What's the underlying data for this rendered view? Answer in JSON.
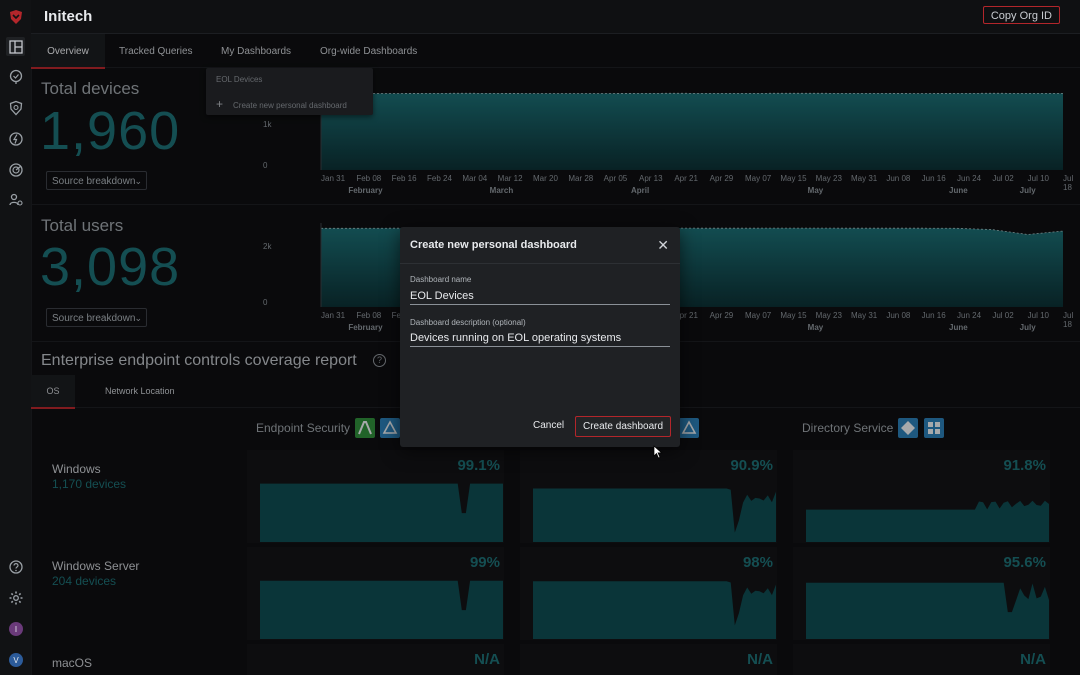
{
  "org": {
    "name": "Initech",
    "copy_label": "Copy Org ID"
  },
  "tabs": [
    "Overview",
    "Tracked Queries",
    "My Dashboards",
    "Org-wide Dashboards"
  ],
  "dropdown": {
    "item1": "EOL Devices",
    "item2": "Create new personal dashboard"
  },
  "devices": {
    "title": "Total devices",
    "count": "1,960",
    "breakdown": "Source breakdown"
  },
  "users": {
    "title": "Total users",
    "count": "3,098",
    "breakdown": "Source breakdown"
  },
  "chart_data": [
    {
      "type": "area",
      "x": [
        "Jan 31",
        "Feb 08",
        "Feb 16",
        "Feb 24",
        "Mar 04",
        "Mar 12",
        "Mar 20",
        "Mar 28",
        "Apr 05",
        "Apr 13",
        "Apr 21",
        "Apr 29",
        "May 07",
        "May 15",
        "May 23",
        "May 31",
        "Jun 08",
        "Jun 16",
        "Jun 24",
        "Jul 02",
        "Jul 10",
        "Jul 18"
      ],
      "months": [
        "February",
        "March",
        "April",
        "May",
        "June",
        "July"
      ],
      "yticks": [
        "0",
        "1k"
      ],
      "values": [
        1950,
        1955,
        1958,
        1960,
        1962,
        1961,
        1958,
        1957,
        1959,
        1960,
        1962,
        1961,
        1960,
        1962,
        1963,
        1961,
        1960,
        1959,
        1960,
        1962,
        1960,
        1960
      ]
    },
    {
      "type": "area",
      "x": [
        "Jan 31",
        "Feb 08",
        "Feb 16",
        "Feb 24",
        "Mar 04",
        "Mar 12",
        "Mar 20",
        "Mar 28",
        "Apr 05",
        "Apr 13",
        "Apr 21",
        "Apr 29",
        "May 07",
        "May 15",
        "May 23",
        "May 31",
        "Jun 08",
        "Jun 16",
        "Jun 24",
        "Jul 02",
        "Jul 10",
        "Jul 18"
      ],
      "months": [
        "February",
        "March",
        "April",
        "May",
        "June",
        "July"
      ],
      "yticks": [
        "0",
        "2k"
      ],
      "values": [
        3090,
        3092,
        3095,
        3094,
        3096,
        3098,
        3097,
        3095,
        3096,
        3098,
        3099,
        3097,
        3096,
        3098,
        3099,
        3097,
        3096,
        3095,
        3090,
        3040,
        2850,
        3098
      ]
    }
  ],
  "coverage": {
    "title": "Enterprise endpoint controls coverage report",
    "subtabs": [
      "OS",
      "Network Location"
    ],
    "columns": [
      "Endpoint Security",
      "",
      "Directory Service"
    ],
    "rows": [
      {
        "name": "Windows",
        "count": "1,170 devices",
        "pcts": [
          "99.1%",
          "90.9%",
          "91.8%"
        ]
      },
      {
        "name": "Windows Server",
        "count": "204 devices",
        "pcts": [
          "99%",
          "98%",
          "95.6%"
        ]
      },
      {
        "name": "macOS",
        "count": "",
        "pcts": [
          "N/A",
          "N/A",
          "N/A"
        ]
      }
    ]
  },
  "modal": {
    "title": "Create new personal dashboard",
    "name_label": "Dashboard name",
    "name_value": "EOL Devices",
    "desc_label": "Dashboard description (optional)",
    "desc_value": "Devices running on EOL operating systems",
    "cancel": "Cancel",
    "create": "Create dashboard"
  },
  "colors": {
    "accent": "#1d6d72",
    "brand_red": "#b3262b"
  }
}
